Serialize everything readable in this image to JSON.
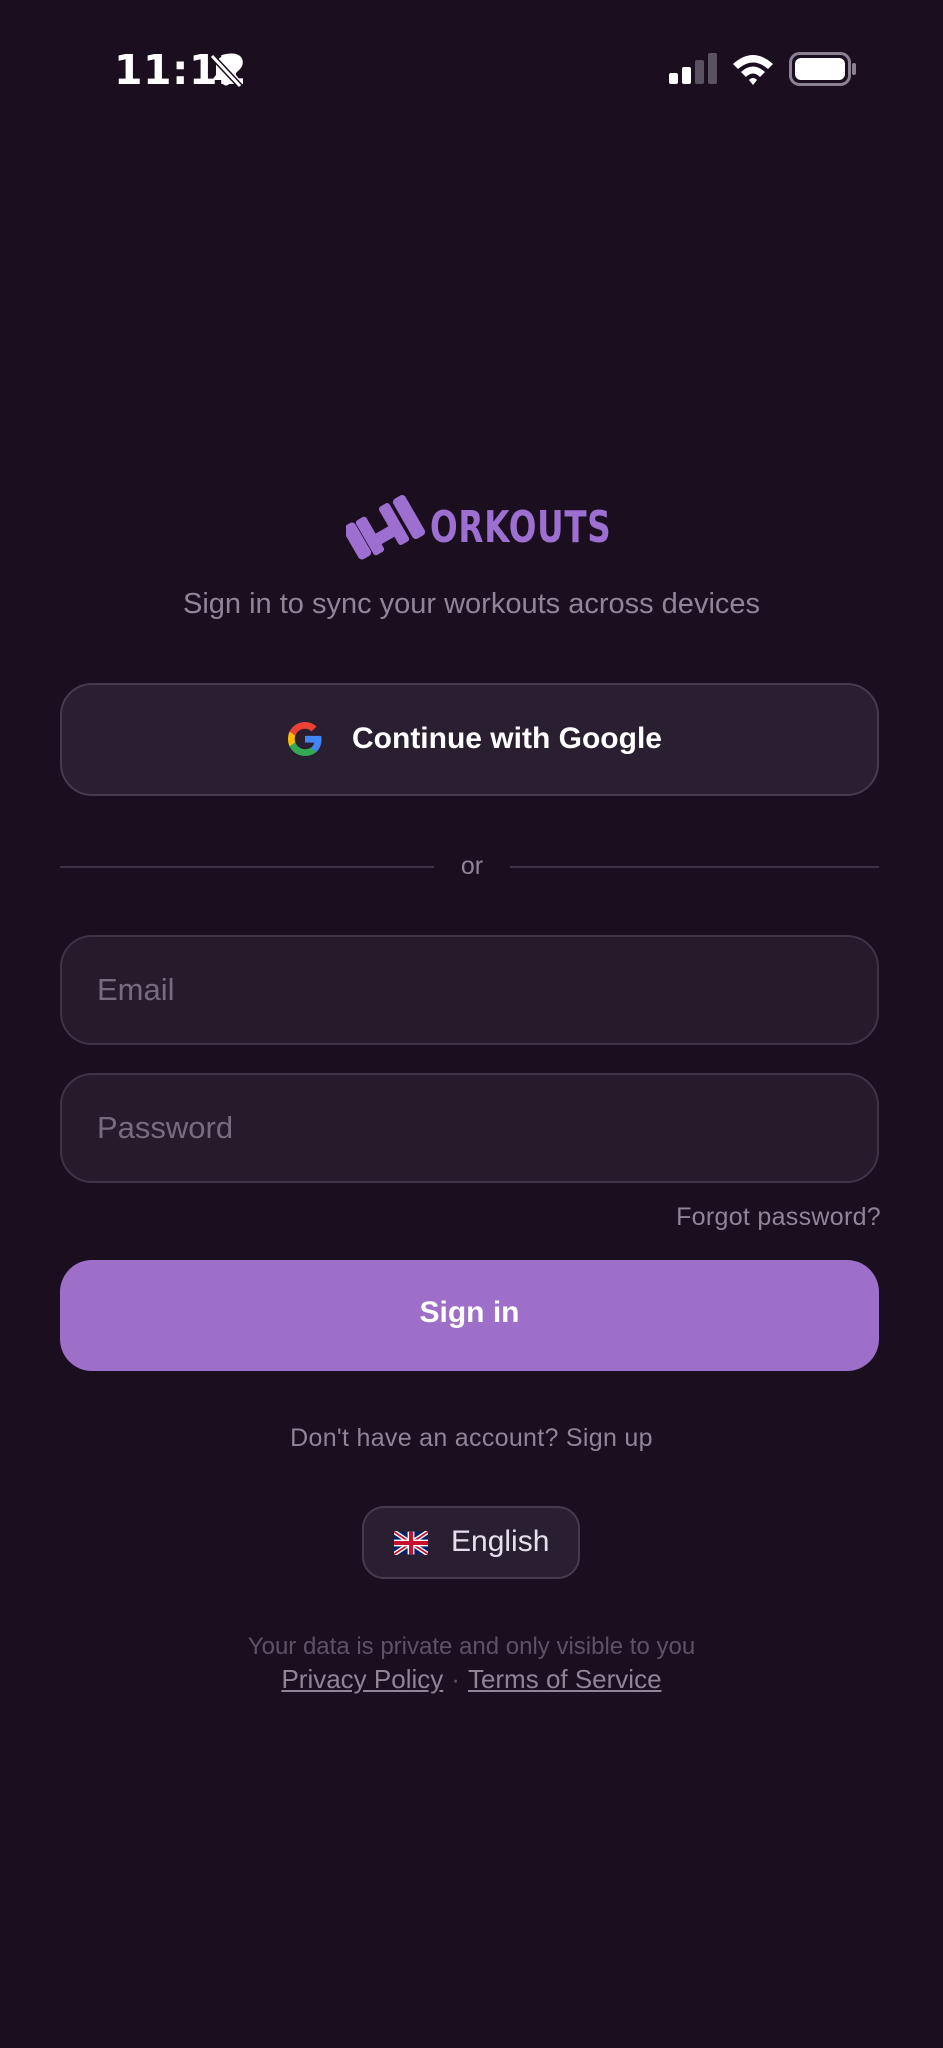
{
  "status_bar": {
    "time": "11:12",
    "icons": [
      "bell-slash-icon",
      "cellular-signal-icon",
      "wifi-icon",
      "battery-icon"
    ]
  },
  "brand": {
    "logo_text": "ORKOUTS",
    "logo_icon": "dumbbell-w-icon",
    "color": "#9d6fd0"
  },
  "subtitle": "Sign in to sync your workouts across devices",
  "google_button": {
    "label": "Continue with Google",
    "icon": "google-icon"
  },
  "divider_text": "or",
  "form": {
    "email": {
      "value": "",
      "placeholder": "Email"
    },
    "password": {
      "value": "",
      "placeholder": "Password"
    },
    "forgot_label": "Forgot password?",
    "submit_label": "Sign in"
  },
  "signup_prompt": "Don't have an account? Sign up",
  "language": {
    "label": "English",
    "flag_icon": "uk-flag-icon"
  },
  "footer": {
    "privacy_note": "Your data is private and only visible to you",
    "privacy_link": "Privacy Policy",
    "separator": "·",
    "terms_link": "Terms of Service"
  },
  "colors": {
    "background": "#1b0e1f",
    "accent": "#9d6fc9",
    "card": "#2a1f30",
    "muted_text": "#8f8596"
  }
}
